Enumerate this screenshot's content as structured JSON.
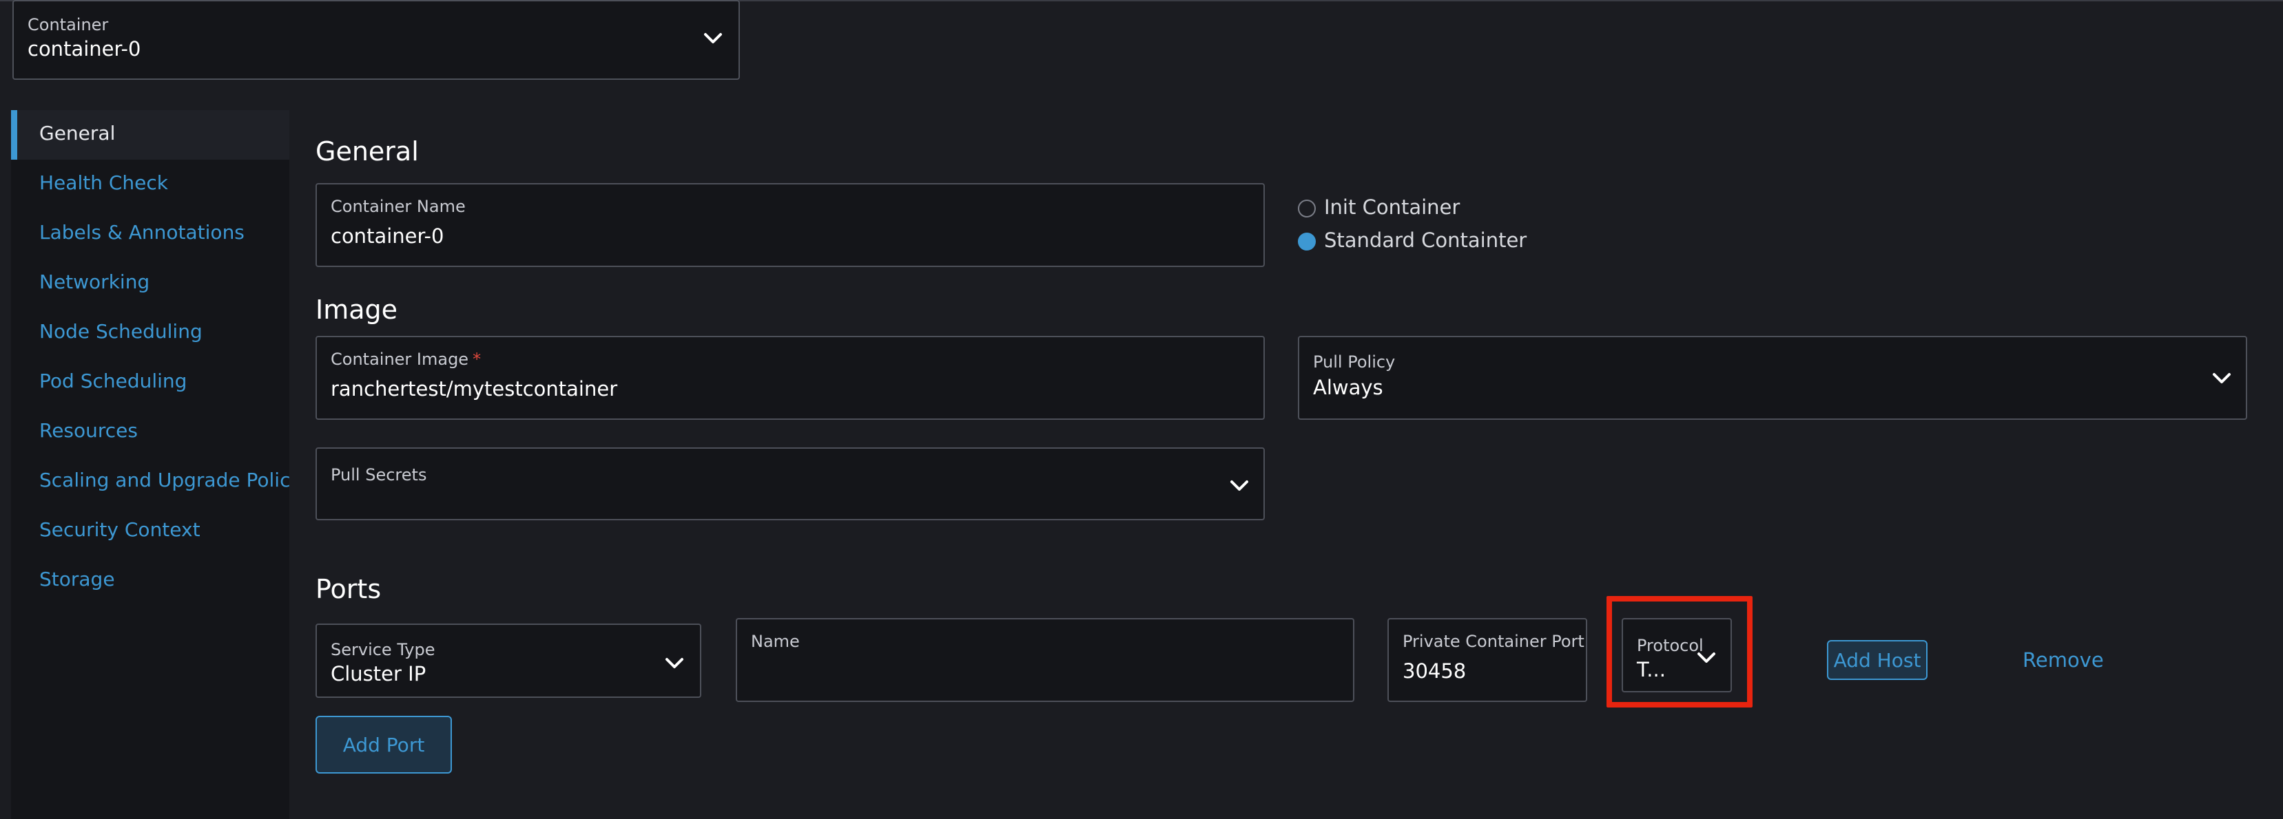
{
  "container_select": {
    "label": "Container",
    "value": "container-0"
  },
  "sidebar": {
    "items": [
      {
        "label": "General"
      },
      {
        "label": "Health Check"
      },
      {
        "label": "Labels & Annotations"
      },
      {
        "label": "Networking"
      },
      {
        "label": "Node Scheduling"
      },
      {
        "label": "Pod Scheduling"
      },
      {
        "label": "Resources"
      },
      {
        "label": "Scaling and Upgrade Policy"
      },
      {
        "label": "Security Context"
      },
      {
        "label": "Storage"
      }
    ]
  },
  "general": {
    "title": "General",
    "container_name": {
      "label": "Container Name",
      "value": "container-0"
    },
    "container_type": {
      "options": [
        {
          "label": "Init Container",
          "selected": false
        },
        {
          "label": "Standard Containter",
          "selected": true
        }
      ]
    }
  },
  "image": {
    "title": "Image",
    "container_image": {
      "label": "Container Image",
      "required_mark": "*",
      "value": "ranchertest/mytestcontainer"
    },
    "pull_policy": {
      "label": "Pull Policy",
      "value": "Always"
    },
    "pull_secrets": {
      "label": "Pull Secrets",
      "value": ""
    }
  },
  "ports": {
    "title": "Ports",
    "service_type": {
      "label": "Service Type",
      "value": "Cluster IP"
    },
    "name": {
      "label": "Name",
      "value": ""
    },
    "private_port": {
      "label": "Private Container Port",
      "value": "30458"
    },
    "protocol": {
      "label": "Protocol",
      "value": "T..."
    },
    "add_host_label": "Add Host",
    "remove_label": "Remove",
    "add_port_label": "Add Port"
  },
  "colors": {
    "accent": "#3d98d3",
    "highlight": "#e8240f",
    "background": "#1b1c21",
    "field_bg": "#141519"
  }
}
